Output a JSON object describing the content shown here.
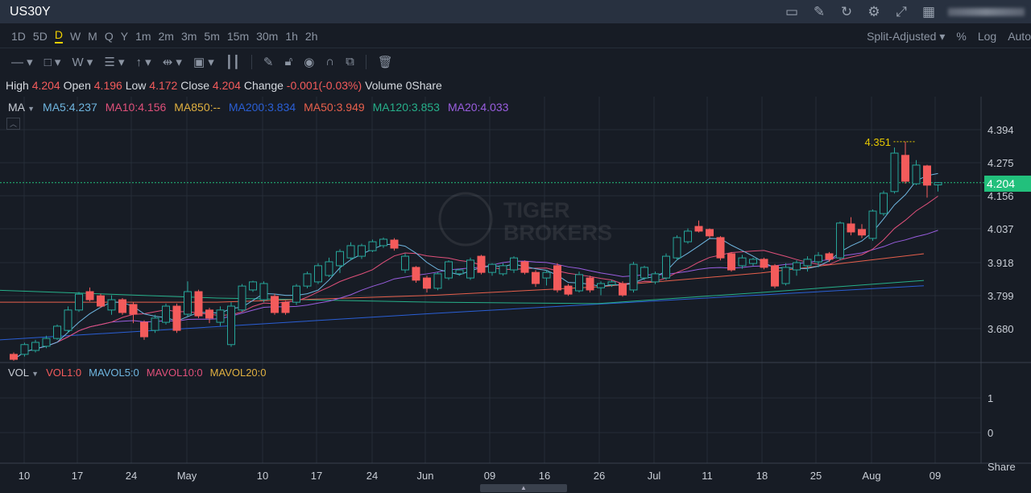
{
  "title": "US30Y",
  "periods": [
    "1D",
    "5D",
    "D",
    "W",
    "M",
    "Q",
    "Y",
    "1m",
    "2m",
    "3m",
    "5m",
    "15m",
    "30m",
    "1h",
    "2h"
  ],
  "active_period": "D",
  "right_options": {
    "adjust": "Split-Adjusted",
    "percent": "%",
    "log": "Log",
    "auto": "Auto"
  },
  "info": {
    "high_label": "High",
    "high": "4.204",
    "open_label": "Open",
    "open": "4.196",
    "low_label": "Low",
    "low": "4.172",
    "close_label": "Close",
    "close": "4.204",
    "change_label": "Change",
    "change": "-0.001(-0.03%)",
    "volume": "Volume 0Share"
  },
  "ma_label": "MA",
  "ma_legend": [
    {
      "text": "MA5:4.237",
      "color": "#6fb6e0"
    },
    {
      "text": "MA10:4.156",
      "color": "#e0507a"
    },
    {
      "text": "MA850:--",
      "color": "#e0b040"
    },
    {
      "text": "MA200:3.834",
      "color": "#2a5fd6"
    },
    {
      "text": "MA50:3.949",
      "color": "#e8604c"
    },
    {
      "text": "MA120:3.853",
      "color": "#26b08a"
    },
    {
      "text": "MA20:4.033",
      "color": "#9a5ee0"
    }
  ],
  "vol_label": "VOL",
  "vol_legend": [
    {
      "text": "VOL1:0",
      "color": "#f45b5b"
    },
    {
      "text": "MAVOL5:0",
      "color": "#6fb6e0"
    },
    {
      "text": "MAVOL10:0",
      "color": "#e0507a"
    },
    {
      "text": "MAVOL20:0",
      "color": "#e0b040"
    }
  ],
  "watermark": "TIGER BROKERS",
  "price_ticks": [
    "4.394",
    "4.275",
    "4.156",
    "4.037",
    "3.918",
    "3.799",
    "3.680"
  ],
  "last_price": "4.204",
  "high_marker": "4.351",
  "vol_ticks": [
    "1",
    "0"
  ],
  "vol_unit": "Share",
  "date_ticks": [
    "10",
    "17",
    "24",
    "May",
    "10",
    "17",
    "24",
    "Jun",
    "09",
    "16",
    "26",
    "Jul",
    "11",
    "18",
    "25",
    "Aug",
    "09"
  ],
  "colors": {
    "up": "#26a69a",
    "down": "#f45b5b"
  },
  "chart_data": {
    "type": "candlestick",
    "ylim": [
      3.55,
      4.42
    ],
    "candles": [
      [
        3.588,
        3.595,
        3.565,
        3.57
      ],
      [
        3.588,
        3.63,
        3.58,
        3.623
      ],
      [
        3.602,
        3.64,
        3.595,
        3.631
      ],
      [
        3.617,
        3.655,
        3.61,
        3.645
      ],
      [
        3.645,
        3.695,
        3.64,
        3.689
      ],
      [
        3.674,
        3.76,
        3.665,
        3.747
      ],
      [
        3.747,
        3.812,
        3.74,
        3.804
      ],
      [
        3.813,
        3.828,
        3.778,
        3.784
      ],
      [
        3.798,
        3.805,
        3.755,
        3.761
      ],
      [
        3.747,
        3.8,
        3.73,
        3.784
      ],
      [
        3.784,
        3.79,
        3.73,
        3.738
      ],
      [
        3.767,
        3.775,
        3.7,
        3.732
      ],
      [
        3.703,
        3.71,
        3.64,
        3.651
      ],
      [
        3.674,
        3.73,
        3.665,
        3.718
      ],
      [
        3.703,
        3.77,
        3.695,
        3.761
      ],
      [
        3.761,
        3.77,
        3.665,
        3.674
      ],
      [
        3.732,
        3.85,
        3.725,
        3.813
      ],
      [
        3.813,
        3.82,
        3.718,
        3.726
      ],
      [
        3.747,
        3.755,
        3.7,
        3.718
      ],
      [
        3.703,
        3.76,
        3.69,
        3.747
      ],
      [
        3.623,
        3.775,
        3.615,
        3.761
      ],
      [
        3.747,
        3.84,
        3.74,
        3.833
      ],
      [
        3.819,
        3.852,
        3.812,
        3.848
      ],
      [
        3.784,
        3.85,
        3.775,
        3.842
      ],
      [
        3.796,
        3.805,
        3.73,
        3.738
      ],
      [
        3.775,
        3.78,
        3.73,
        3.738
      ],
      [
        3.775,
        3.84,
        3.765,
        3.833
      ],
      [
        3.833,
        3.885,
        3.825,
        3.877
      ],
      [
        3.848,
        3.915,
        3.84,
        3.906
      ],
      [
        3.871,
        3.935,
        3.865,
        3.92
      ],
      [
        3.906,
        3.965,
        3.88,
        3.957
      ],
      [
        3.934,
        3.99,
        3.925,
        3.978
      ],
      [
        3.94,
        3.985,
        3.93,
        3.978
      ],
      [
        3.96,
        4.0,
        3.955,
        3.992
      ],
      [
        3.978,
        4.007,
        3.97,
        4.001
      ],
      [
        3.998,
        4.005,
        3.96,
        3.969
      ],
      [
        3.891,
        3.95,
        3.88,
        3.94
      ],
      [
        3.9,
        3.905,
        3.845,
        3.854
      ],
      [
        3.862,
        3.87,
        3.81,
        3.825
      ],
      [
        3.825,
        3.882,
        3.818,
        3.877
      ],
      [
        3.862,
        3.925,
        3.855,
        3.92
      ],
      [
        3.877,
        3.895,
        3.87,
        3.891
      ],
      [
        3.862,
        3.935,
        3.855,
        3.926
      ],
      [
        3.94,
        3.945,
        3.875,
        3.882
      ],
      [
        3.882,
        3.915,
        3.87,
        3.911
      ],
      [
        3.877,
        3.915,
        3.87,
        3.906
      ],
      [
        3.891,
        3.94,
        3.88,
        3.934
      ],
      [
        3.92,
        3.925,
        3.875,
        3.882
      ],
      [
        3.882,
        3.89,
        3.83,
        3.842
      ],
      [
        3.862,
        3.89,
        3.835,
        3.882
      ],
      [
        3.906,
        3.915,
        3.81,
        3.819
      ],
      [
        3.833,
        3.84,
        3.798,
        3.804
      ],
      [
        3.816,
        3.885,
        3.81,
        3.874
      ],
      [
        3.862,
        3.87,
        3.81,
        3.819
      ],
      [
        3.827,
        3.85,
        3.8,
        3.842
      ],
      [
        3.838,
        3.855,
        3.83,
        3.848
      ],
      [
        3.842,
        3.85,
        3.795,
        3.801
      ],
      [
        3.819,
        3.92,
        3.81,
        3.911
      ],
      [
        3.862,
        3.906,
        3.855,
        3.9
      ],
      [
        3.848,
        3.885,
        3.84,
        3.877
      ],
      [
        3.862,
        3.95,
        3.855,
        3.94
      ],
      [
        3.934,
        4.015,
        3.925,
        4.007
      ],
      [
        3.992,
        4.04,
        3.985,
        4.03
      ],
      [
        4.047,
        4.068,
        4.025,
        4.03
      ],
      [
        4.036,
        4.04,
        4.005,
        4.013
      ],
      [
        4.007,
        4.012,
        3.925,
        3.934
      ],
      [
        3.949,
        3.955,
        3.885,
        3.891
      ],
      [
        3.906,
        3.945,
        3.895,
        3.934
      ],
      [
        3.914,
        3.935,
        3.905,
        3.929
      ],
      [
        3.929,
        3.935,
        3.893,
        3.9
      ],
      [
        3.906,
        3.912,
        3.825,
        3.833
      ],
      [
        3.842,
        3.915,
        3.835,
        3.9
      ],
      [
        3.891,
        3.925,
        3.87,
        3.917
      ],
      [
        3.906,
        3.94,
        3.885,
        3.929
      ],
      [
        3.92,
        3.955,
        3.9,
        3.943
      ],
      [
        3.949,
        3.955,
        3.92,
        3.929
      ],
      [
        3.934,
        4.065,
        3.925,
        4.059
      ],
      [
        4.056,
        4.08,
        4.015,
        4.027
      ],
      [
        4.036,
        4.055,
        4.005,
        4.016
      ],
      [
        4.004,
        4.108,
        3.995,
        4.102
      ],
      [
        4.093,
        4.175,
        4.085,
        4.166
      ],
      [
        4.172,
        4.33,
        4.165,
        4.31
      ],
      [
        4.302,
        4.351,
        4.2,
        4.209
      ],
      [
        4.2,
        4.285,
        4.195,
        4.267
      ],
      [
        4.264,
        4.268,
        4.15,
        4.195
      ],
      [
        4.196,
        4.206,
        4.172,
        4.204
      ]
    ],
    "ma_long": {
      "ma200": [
        [
          0,
          3.64
        ],
        [
          40,
          3.735
        ],
        [
          85,
          3.834
        ]
      ],
      "ma120": [
        [
          0,
          3.818
        ],
        [
          20,
          3.79
        ],
        [
          40,
          3.775
        ],
        [
          55,
          3.77
        ],
        [
          70,
          3.81
        ],
        [
          85,
          3.853
        ]
      ],
      "ma50": [
        [
          0,
          3.775
        ],
        [
          20,
          3.775
        ],
        [
          40,
          3.8
        ],
        [
          55,
          3.83
        ],
        [
          70,
          3.88
        ],
        [
          85,
          3.949
        ]
      ]
    }
  }
}
